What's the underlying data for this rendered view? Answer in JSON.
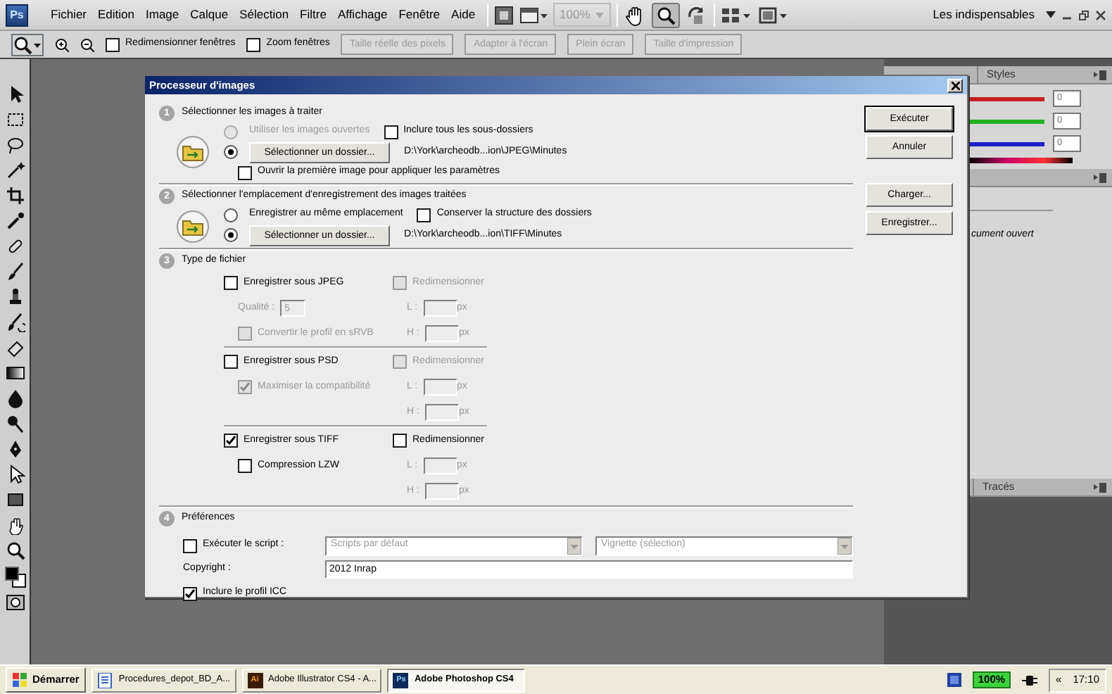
{
  "app": {
    "logo": "Ps",
    "menu": [
      "Fichier",
      "Edition",
      "Image",
      "Calque",
      "Sélection",
      "Filtre",
      "Affichage",
      "Fenêtre",
      "Aide"
    ],
    "zoom_level": "100%",
    "workspace": "Les indispensables"
  },
  "options_bar": {
    "checkboxes": [
      {
        "label": "Redimensionner fenêtres",
        "checked": false
      },
      {
        "label": "Zoom fenêtres",
        "checked": false
      }
    ],
    "buttons": [
      {
        "label": "Taille réelle des pixels",
        "disabled": true
      },
      {
        "label": "Adapter à l'écran",
        "disabled": true
      },
      {
        "label": "Plein écran",
        "disabled": true
      },
      {
        "label": "Taille d'impression",
        "disabled": true
      }
    ]
  },
  "panels": {
    "top_tab": "Styles",
    "color_values": [
      "0",
      "0",
      "0"
    ],
    "layers_text": "cument ouvert",
    "bottom_tab": "Tracés"
  },
  "dialog": {
    "title": "Processeur d'images",
    "sections": [
      {
        "number": "1",
        "title": "Sélectionner les images à traiter",
        "rows": [
          {
            "kind": "option",
            "radio": {
              "label": "Utiliser les images ouvertes",
              "selected": false,
              "disabled": true
            },
            "checkbox": {
              "label": "Inclure tous les sous-dossiers",
              "checked": false
            }
          },
          {
            "kind": "folder",
            "radio": {
              "selected": true
            },
            "button": "Sélectionner un dossier...",
            "path": "D:\\York\\archeodb...ion\\JPEG\\Minutes"
          },
          {
            "kind": "check",
            "checkbox": {
              "label": "Ouvrir la première image pour appliquer les paramètres",
              "checked": false
            }
          }
        ]
      },
      {
        "number": "2",
        "title": "Sélectionner l'emplacement d'enregistrement des images traitées",
        "rows": [
          {
            "kind": "option",
            "radio": {
              "label": "Enregistrer au même emplacement",
              "selected": false
            },
            "checkbox": {
              "label": "Conserver la structure des dossiers",
              "checked": false
            }
          },
          {
            "kind": "folder",
            "radio": {
              "selected": true
            },
            "button": "Sélectionner un dossier...",
            "path": "D:\\York\\archeodb...ion\\TIFF\\Minutes"
          }
        ]
      },
      {
        "number": "3",
        "title": "Type de fichier",
        "formats": [
          {
            "save": {
              "label": "Enregistrer sous JPEG",
              "checked": false
            },
            "options": [
              {
                "kind": "quality",
                "label": "Qualité :",
                "value": "5",
                "disabled": true
              },
              {
                "kind": "checkbox",
                "label": "Convertir le profil en sRVB",
                "checked": false,
                "disabled": true
              }
            ],
            "resize": {
              "label": "Redimensionner",
              "checked": false,
              "disabled": true
            },
            "width": {
              "label": "L :",
              "unit": "px",
              "disabled": true
            },
            "height": {
              "label": "H :",
              "unit": "px",
              "disabled": true
            }
          },
          {
            "save": {
              "label": "Enregistrer sous PSD",
              "checked": false
            },
            "options": [
              {
                "kind": "checkbox",
                "label": "Maximiser la compatibilité",
                "checked": true,
                "disabled": true
              }
            ],
            "resize": {
              "label": "Redimensionner",
              "checked": false,
              "disabled": true
            },
            "width": {
              "label": "L :",
              "unit": "px",
              "disabled": true
            },
            "height": {
              "label": "H :",
              "unit": "px",
              "disabled": true
            }
          },
          {
            "save": {
              "label": "Enregistrer sous TIFF",
              "checked": true
            },
            "options": [
              {
                "kind": "checkbox",
                "label": "Compression LZW",
                "checked": false
              }
            ],
            "resize": {
              "label": "Redimensionner",
              "checked": false
            },
            "width": {
              "label": "L :",
              "unit": "px",
              "disabled": true
            },
            "height": {
              "label": "H :",
              "unit": "px",
              "disabled": true
            }
          }
        ]
      },
      {
        "number": "4",
        "title": "Préférences",
        "preferences": {
          "script": {
            "label": "Exécuter le script :",
            "checked": false
          },
          "selects": [
            {
              "value": "Scripts par défaut",
              "disabled": true
            },
            {
              "value": "Vignette (sélection)",
              "disabled": true
            }
          ],
          "copyright": {
            "label": "Copyright :",
            "value": "2012 Inrap"
          },
          "icc": {
            "label": "Inclure le profil ICC",
            "checked": true
          }
        }
      }
    ],
    "button_groups": [
      [
        {
          "label": "Exécuter",
          "default": true
        },
        {
          "label": "Annuler",
          "default": false
        }
      ],
      [
        {
          "label": "Charger...",
          "default": false
        },
        {
          "label": "Enregistrer...",
          "default": false
        }
      ]
    ]
  },
  "taskbar": {
    "start": "Démarrer",
    "tasks": [
      {
        "kind": "document",
        "label": "Procedures_depot_BD_A...",
        "selected": false
      },
      {
        "kind": "illustrator",
        "badge": "Ai",
        "label": "Adobe Illustrator CS4 - A...",
        "selected": false
      },
      {
        "kind": "photoshop",
        "badge": "Ps",
        "label": "Adobe Photoshop CS4",
        "selected": true
      }
    ],
    "battery": "100%",
    "tray_toggle": "«",
    "clock": "17:10"
  }
}
